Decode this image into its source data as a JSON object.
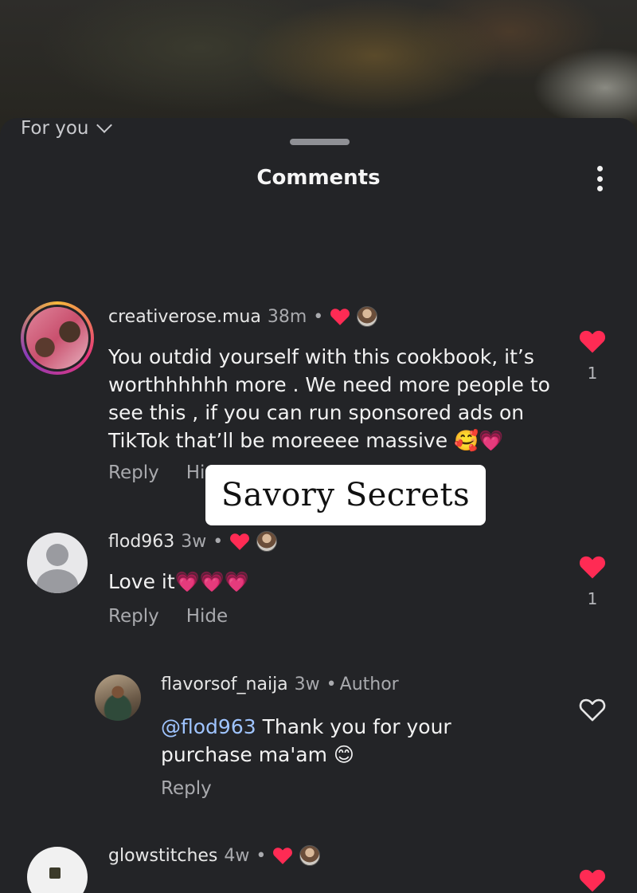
{
  "header": {
    "title": "Comments"
  },
  "sort": {
    "label": "For you"
  },
  "overlay": {
    "text": "Savory Secrets"
  },
  "comments": [
    {
      "username": "creativerose.mua",
      "time": "38m",
      "text_lines": [
        "You outdid yourself with this cookbook, it’s",
        "worthhhhhh more . We need more people to",
        "see this , if you can run sponsored ads on",
        "TikTok that’ll be moreeee massive 🥰💗"
      ],
      "reply_label": "Reply",
      "hide_label": "Hi",
      "like_count": "1",
      "liked": true
    },
    {
      "username": "flod963",
      "time": "3w",
      "text": "Love it💗💗💗",
      "reply_label": "Reply",
      "hide_label": "Hide",
      "like_count": "1",
      "liked": true
    },
    {
      "username": "flavorsof_naija",
      "time": "3w",
      "author_label": "Author",
      "mention": "@flod963",
      "text_line1": " Thank you for your",
      "text_line2": "purchase ma'am 😊",
      "reply_label": "Reply",
      "liked": false
    },
    {
      "username": "glowstitches",
      "time": "4w",
      "liked": true
    }
  ],
  "colors": {
    "heart": "#ff2b54",
    "sheet": "#232427",
    "mention": "#9fc4ff"
  }
}
